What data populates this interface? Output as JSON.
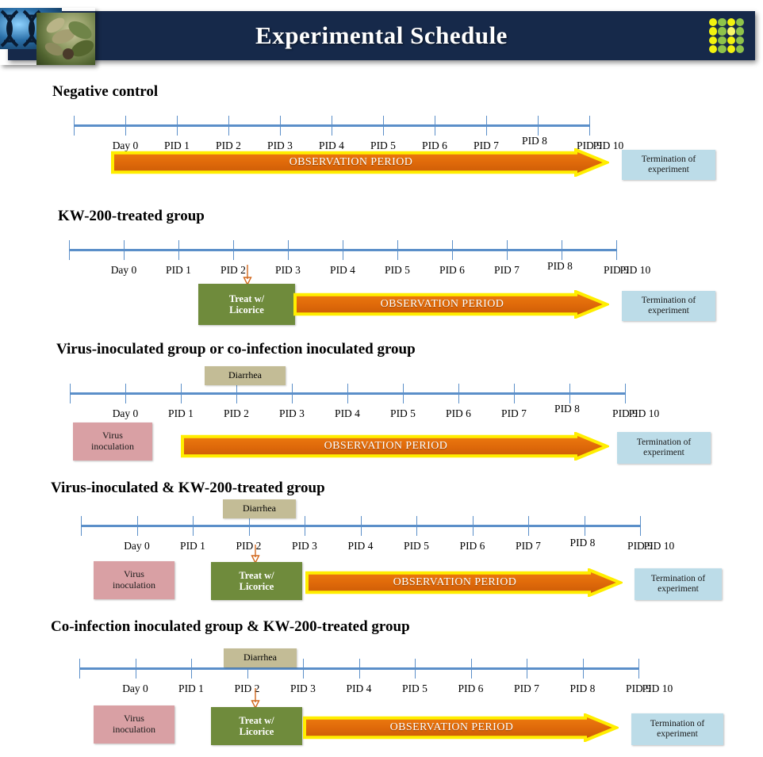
{
  "header": {
    "title": "Experimental Schedule",
    "left_image_alt": "dna-and-plant-collage",
    "dot_grid_colors": [
      "#f2f20f",
      "#8fc34a",
      "#f2f20f",
      "#8fc34a",
      "#f2f20f",
      "#8fc34a",
      "#f7f76a",
      "#8fc34a",
      "#f2f20f",
      "#8fc34a",
      "#f2f20f",
      "#8fc34a",
      "#f2f20f",
      "#8fc34a",
      "#f2f20f",
      "#8fc34a"
    ],
    "banner_color": "#16294a"
  },
  "colors": {
    "axis": "#5b8fc9",
    "observation_fill": "#e06a0a",
    "observation_outline": "#ffee00",
    "termination": "#bcdce8",
    "virus": "#d9a0a4",
    "treat": "#6f8b3c",
    "diarrhea": "#c3bc96",
    "title_text": "#000000"
  },
  "labels": {
    "day0": "Day 0",
    "pid": [
      "PID 1",
      "PID 2",
      "PID 3",
      "PID 4",
      "PID 5",
      "PID 6",
      "PID 7",
      "PID 8",
      "PID 9",
      "PID 10"
    ],
    "observation": "OBSERVATION  PERIOD",
    "termination_line1": "Termination of",
    "termination_line2": "experiment",
    "virus_line1": "Virus",
    "virus_line2": "inoculation",
    "treat_line1": "Treat w/",
    "treat_line2": "Licorice",
    "diarrhea": "Diarrhea"
  },
  "sections": [
    {
      "id": "negative-control",
      "title": "Negative control",
      "ticks": [
        "Day 0",
        "PID 1",
        "PID 2",
        "PID 3",
        "PID 4",
        "PID 5",
        "PID 6",
        "PID 7",
        "PID 8",
        "PID 9",
        "PID 10"
      ],
      "has_virus": false,
      "has_treat": false,
      "has_diarrhea": false,
      "has_observation": true,
      "has_termination": true,
      "observation_start": "Day 0",
      "observation_end": "PID 8"
    },
    {
      "id": "kw200-treated",
      "title": "KW-200-treated group",
      "ticks": [
        "Day 0",
        "PID 1",
        "PID 2",
        "PID 3",
        "PID 4",
        "PID 5",
        "PID 6",
        "PID 7",
        "PID 8",
        "PID 9",
        "PID 10"
      ],
      "has_virus": false,
      "has_treat": true,
      "has_diarrhea": false,
      "has_observation": true,
      "has_termination": true,
      "treat_at": "PID 2",
      "observation_start": "PID 3",
      "observation_end": "PID 8"
    },
    {
      "id": "virus-inoculated-or-coinfection",
      "title": "Virus-inoculated group or co-infection inoculated group",
      "ticks": [
        "Day 0",
        "PID 1",
        "PID 2",
        "PID 3",
        "PID 4",
        "PID 5",
        "PID 6",
        "PID 7",
        "PID 8",
        "PID 9",
        "PID 10"
      ],
      "has_virus": true,
      "has_treat": false,
      "has_diarrhea": true,
      "has_observation": true,
      "has_termination": true,
      "diarrhea_span": "PID 1 to PID 3",
      "observation_start": "PID 1",
      "observation_end": "PID 8"
    },
    {
      "id": "virus-inoculated-and-kw200",
      "title": "Virus-inoculated & KW-200-treated group",
      "ticks": [
        "Day 0",
        "PID 1",
        "PID 2",
        "PID 3",
        "PID 4",
        "PID 5",
        "PID 6",
        "PID 7",
        "PID 8",
        "PID 9",
        "PID 10"
      ],
      "has_virus": true,
      "has_treat": true,
      "has_diarrhea": true,
      "has_observation": true,
      "has_termination": true,
      "treat_at": "PID 2",
      "diarrhea_span": "PID 1 to PID 3",
      "observation_start": "PID 3",
      "observation_end": "PID 8"
    },
    {
      "id": "coinfection-and-kw200",
      "title": "Co-infection inoculated group & KW-200-treated group",
      "ticks": [
        "Day 0",
        "PID 1",
        "PID 2",
        "PID 3",
        "PID 4",
        "PID 5",
        "PID 6",
        "PID 7",
        "PID 8",
        "PID 9",
        "PID 10"
      ],
      "has_virus": true,
      "has_treat": true,
      "has_diarrhea": true,
      "has_observation": true,
      "has_termination": true,
      "treat_at": "PID 2",
      "diarrhea_span": "PID 1 to PID 3",
      "observation_start": "PID 3",
      "observation_end": "PID 8"
    }
  ]
}
